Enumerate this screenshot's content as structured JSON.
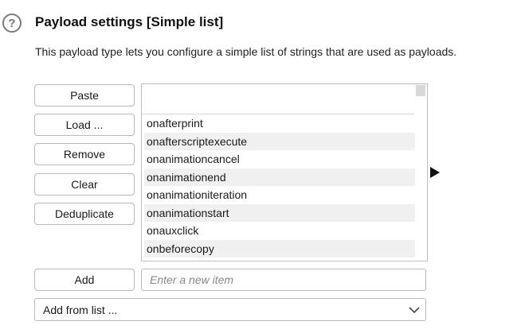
{
  "section": {
    "title": "Payload settings [Simple list]",
    "description": "This payload type lets you configure a simple list of strings that are used as payloads."
  },
  "buttons": {
    "paste": "Paste",
    "load": "Load ...",
    "remove": "Remove",
    "clear": "Clear",
    "deduplicate": "Deduplicate",
    "add": "Add"
  },
  "list": {
    "items": [
      "onafterprint",
      "onafterscriptexecute",
      "onanimationcancel",
      "onanimationend",
      "onanimationiteration",
      "onanimationstart",
      "onauxclick",
      "onbeforecopy"
    ]
  },
  "new_item": {
    "placeholder": "Enter a new item",
    "value": ""
  },
  "add_from_list": {
    "selected": "Add from list ..."
  },
  "icons": {
    "help": "help-icon",
    "arrow": "arrow-right-icon",
    "chevron": "chevron-down-icon"
  }
}
